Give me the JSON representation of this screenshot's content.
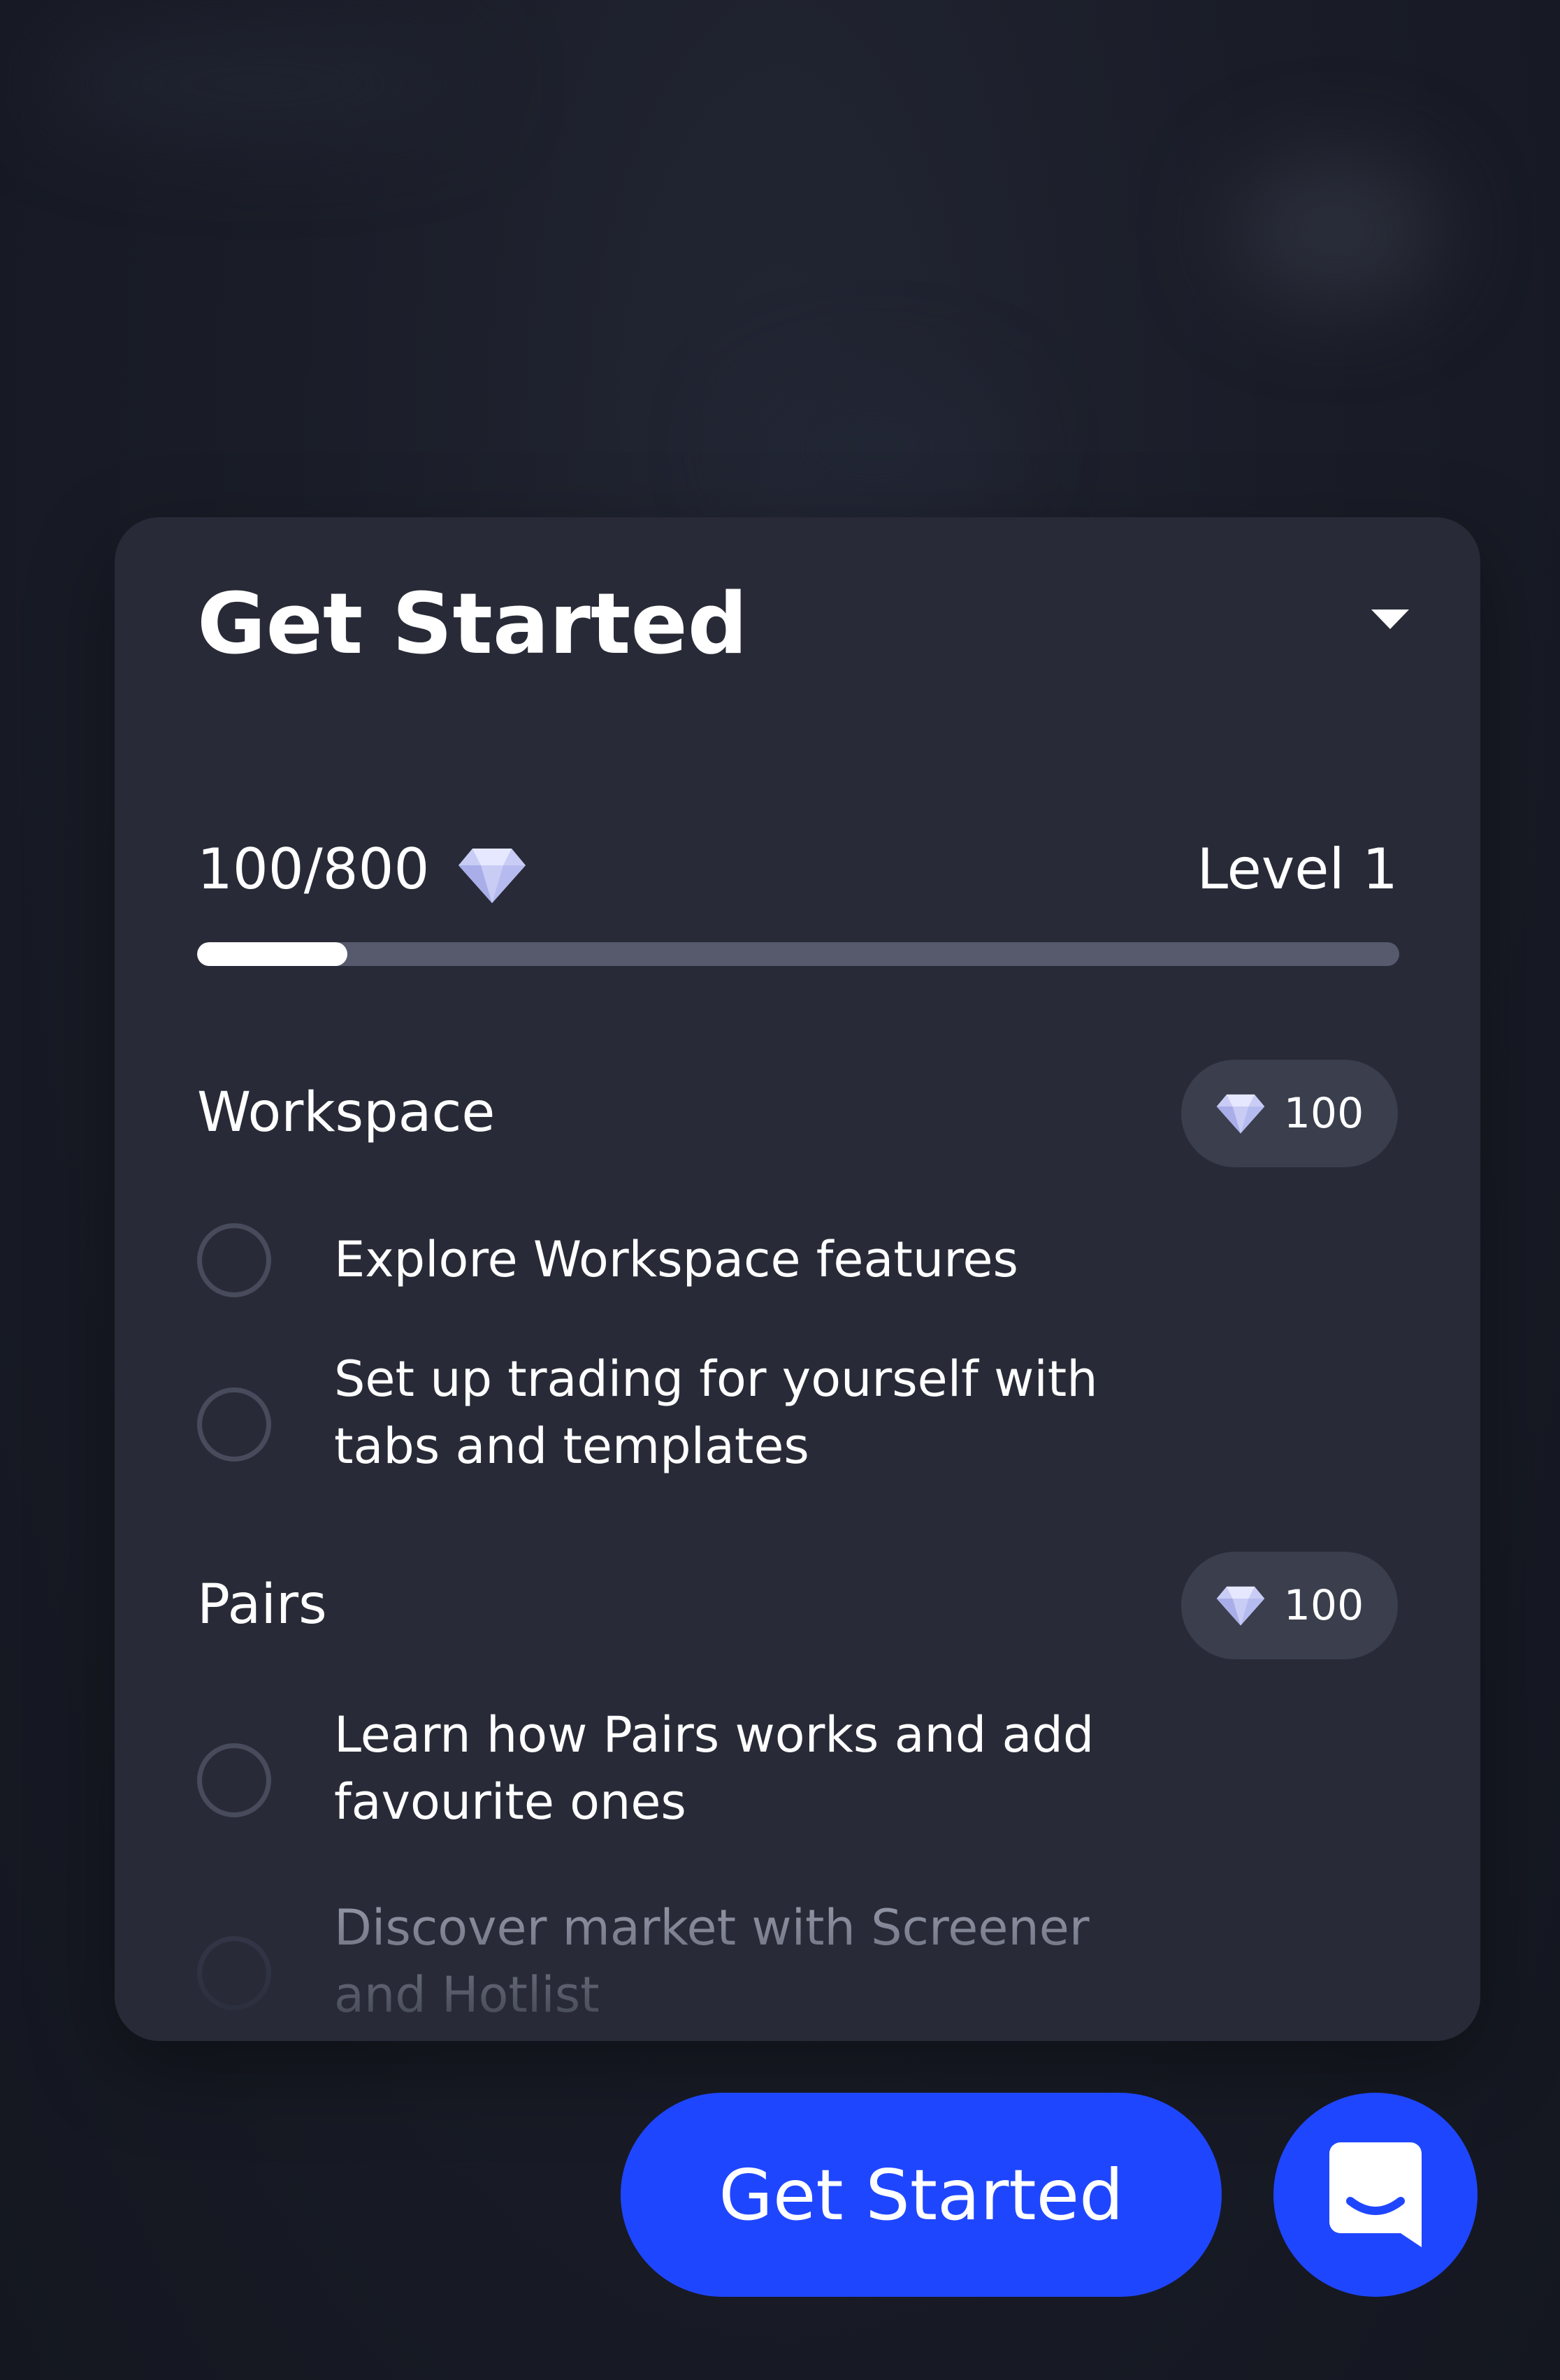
{
  "panel": {
    "title": "Get Started",
    "collapse_icon": "caret-down-icon"
  },
  "progress": {
    "value_label": "100/800",
    "current": 100,
    "max": 800,
    "level_label": "Level 1",
    "fill_fraction": 0.125,
    "gem_icon": "diamond-icon"
  },
  "sections": [
    {
      "label": "Workspace",
      "reward": "100",
      "tasks": [
        {
          "label": "Explore Workspace features",
          "done": false
        },
        {
          "label": "Set up trading for yourself with tabs and templates",
          "done": false
        }
      ]
    },
    {
      "label": "Pairs",
      "reward": "100",
      "tasks": [
        {
          "label": "Learn how Pairs works and add favourite ones",
          "done": false
        },
        {
          "label": "Discover market with Screener and Hotlist",
          "done": false
        }
      ]
    }
  ],
  "cta": {
    "label": "Get Started"
  },
  "chat": {
    "icon": "chat-support-icon"
  },
  "colors": {
    "accent": "#1f46ff",
    "card": "#282b37",
    "badge": "#3a3e4d",
    "track": "#565a6c",
    "gem": "#c9cdf5"
  }
}
